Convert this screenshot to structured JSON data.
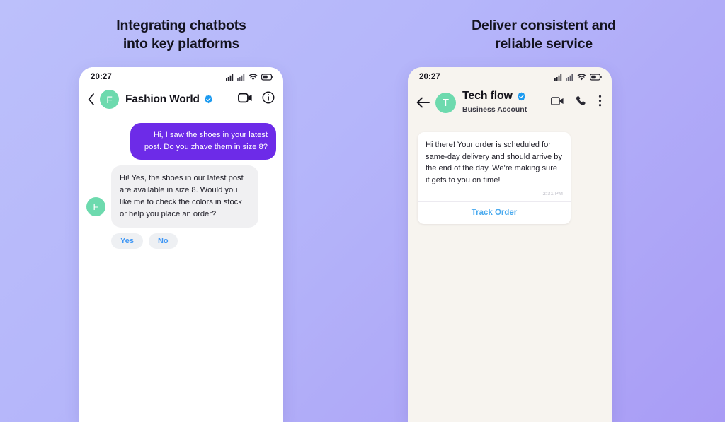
{
  "background": {
    "gradient_from": "#bcc0fb",
    "gradient_to": "#a99cf5"
  },
  "panels": [
    {
      "id": "left",
      "headline_line1": "Integrating chatbots",
      "headline_line2": "into key platforms",
      "phone": {
        "status_bar": {
          "time": "20:27",
          "icons": [
            "signal-icon",
            "signal-icon",
            "wifi-icon",
            "battery-icon"
          ]
        },
        "header": {
          "back_icon": "chevron-left-icon",
          "avatar_initial": "F",
          "avatar_color": "#6ddaae",
          "name": "Fashion World",
          "verified": true,
          "verified_color": "#1d9bf0",
          "actions": [
            "video-camera-icon",
            "info-circle-icon"
          ]
        },
        "messages": [
          {
            "direction": "outgoing",
            "text": "Hi, I saw the shoes in your latest post. Do you zhave them in size 8?",
            "bubble_color": "#6d2be8",
            "text_color": "#ffffff"
          },
          {
            "direction": "incoming",
            "avatar_initial": "F",
            "text": "Hi! Yes, the shoes in our latest post are available in size 8. Would you like me to check the colors in stock or help you place an order?",
            "bubble_color": "#f0f0f2",
            "text_color": "#1d1c26"
          }
        ],
        "quick_replies": [
          {
            "label": "Yes"
          },
          {
            "label": "No"
          }
        ],
        "quick_reply_text_color": "#3f97f5",
        "screen_background": "#ffffff"
      }
    },
    {
      "id": "right",
      "headline_line1": "Deliver consistent and",
      "headline_line2": "reliable service",
      "phone": {
        "status_bar": {
          "time": "20:27",
          "icons": [
            "signal-icon",
            "signal-icon",
            "wifi-icon",
            "battery-icon"
          ]
        },
        "header": {
          "back_icon": "arrow-left-icon",
          "avatar_initial": "T",
          "avatar_color": "#6ddaae",
          "name": "Tech flow",
          "subtitle": "Business Account",
          "verified": true,
          "verified_color": "#1d9bf0",
          "actions": [
            "video-camera-icon",
            "phone-icon",
            "more-vertical-icon"
          ]
        },
        "card": {
          "text": "Hi there! Your order is scheduled for same-day delivery and should arrive by the end of the day. We're making sure it gets to you on time!",
          "timestamp": "2:31 PM",
          "action_label": "Track Order",
          "action_color": "#4aaaee"
        },
        "screen_background": "#f7f4ef"
      }
    }
  ]
}
